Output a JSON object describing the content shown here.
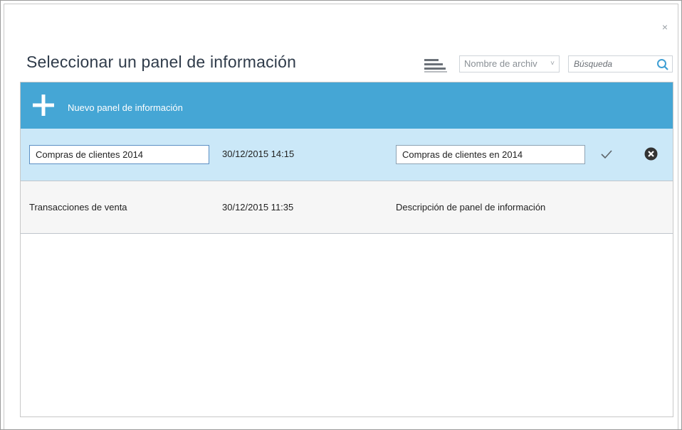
{
  "dialog": {
    "title": "Seleccionar un panel de información",
    "close_glyph": "×"
  },
  "toolbar": {
    "sort_select": {
      "value": "Nombre de archiv",
      "chevron": "˅"
    },
    "search": {
      "placeholder": "Búsqueda"
    }
  },
  "list": {
    "new_item_label": "Nuevo panel de información",
    "rows": [
      {
        "name": "Compras de clientes 2014",
        "date": "30/12/2015 14:15",
        "description": "Compras de clientes en 2014",
        "editing": true
      },
      {
        "name": "Transacciones de venta",
        "date": "30/12/2015 11:35",
        "description": "Descripción de panel de información",
        "editing": false
      }
    ]
  },
  "icons": {
    "close": "close-icon",
    "sort": "sort-icon",
    "search": "search-icon",
    "add": "plus-icon",
    "confirm": "check-icon",
    "cancel": "cancel-circle-icon"
  },
  "colors": {
    "accent": "#45a6d5",
    "selected_row": "#cbe8f8",
    "title": "#2f3b4a"
  }
}
